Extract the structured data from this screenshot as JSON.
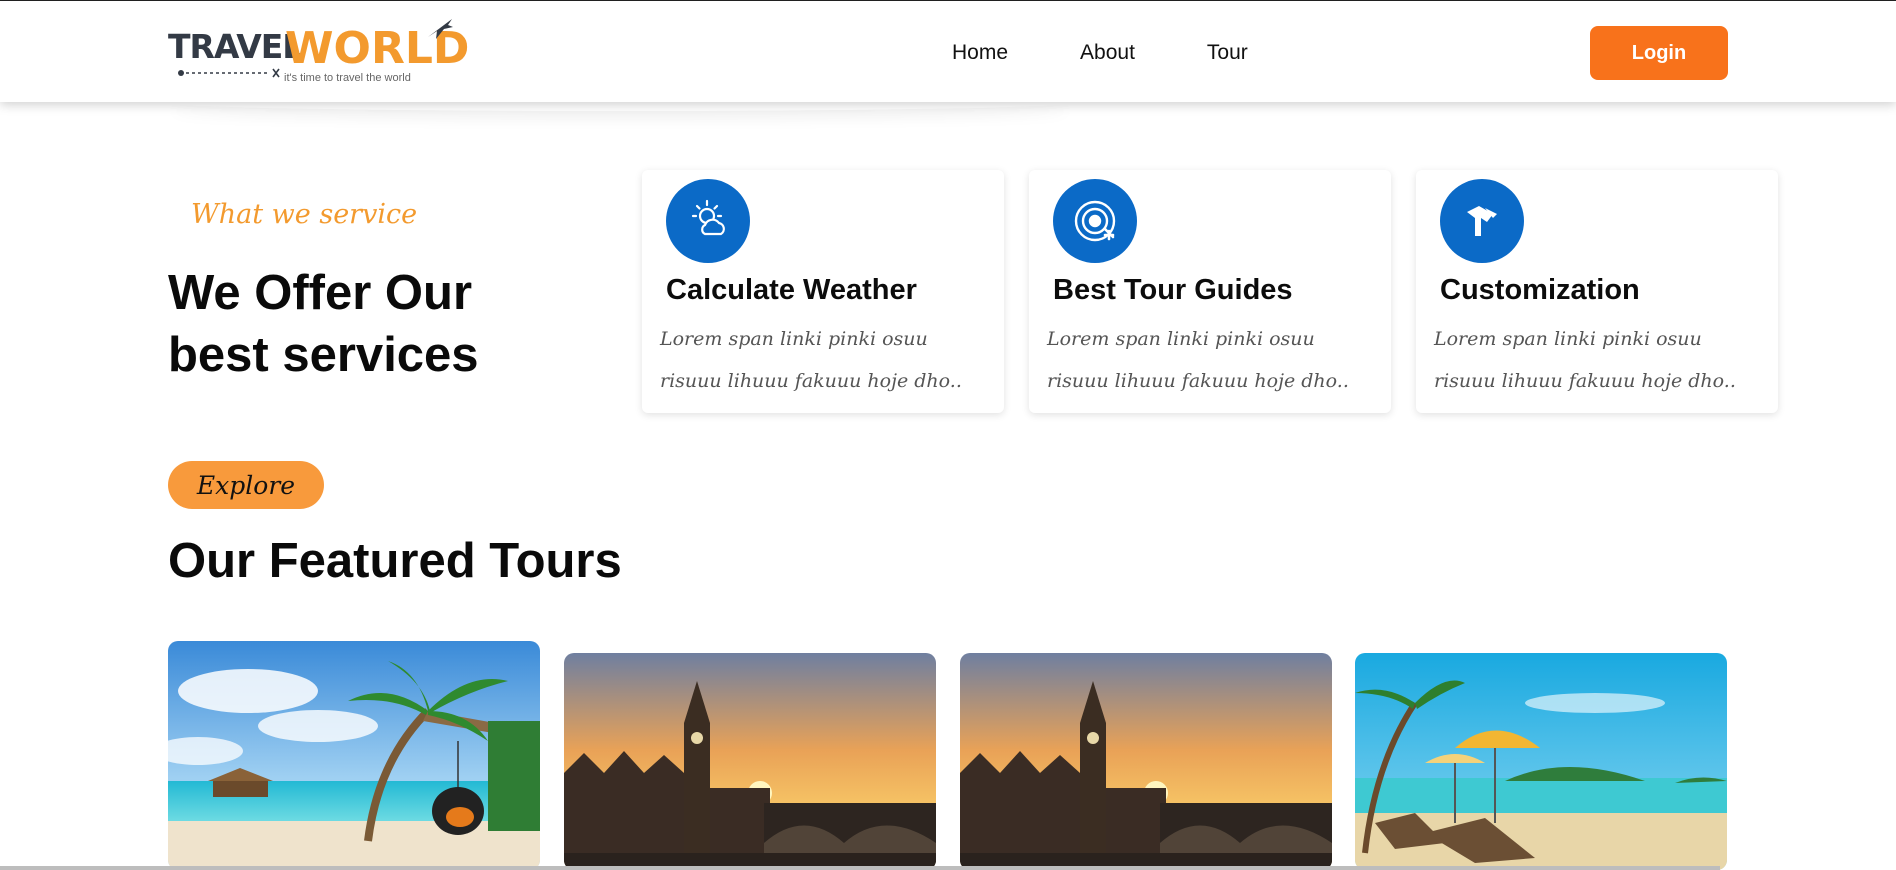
{
  "header": {
    "logo": {
      "travel": "TRAVEL",
      "world": "WORLD",
      "tagline": "it's time to travel the world"
    },
    "nav": [
      "Home",
      "About",
      "Tour"
    ],
    "login_label": "Login"
  },
  "services": {
    "eyebrow": "What we service",
    "headline_line1": "We Offer Our",
    "headline_line2": "best services",
    "cards": [
      {
        "icon": "weather-icon",
        "title": "Calculate Weather",
        "desc": "Lorem span linki pinki osuu risuuu lihuuu fakuuu hoje dho.."
      },
      {
        "icon": "tour-guide-icon",
        "title": "Best Tour Guides",
        "desc": "Lorem span linki pinki osuu risuuu lihuuu fakuuu hoje dho.."
      },
      {
        "icon": "customization-icon",
        "title": "Customization",
        "desc": "Lorem span linki pinki osuu risuuu lihuuu fakuuu hoje dho.."
      }
    ]
  },
  "featured": {
    "explore_label": "Explore",
    "headline": "Our Featured Tours",
    "tours": [
      {
        "image": "beach-palm-swing-image"
      },
      {
        "image": "london-big-ben-image"
      },
      {
        "image": "london-big-ben-image"
      },
      {
        "image": "beach-umbrella-image"
      }
    ]
  },
  "colors": {
    "accent": "#f8721b",
    "eyebrow": "#f39a2e",
    "icon_bg": "#0b6ac7",
    "explore_bg": "#f89a3c"
  }
}
